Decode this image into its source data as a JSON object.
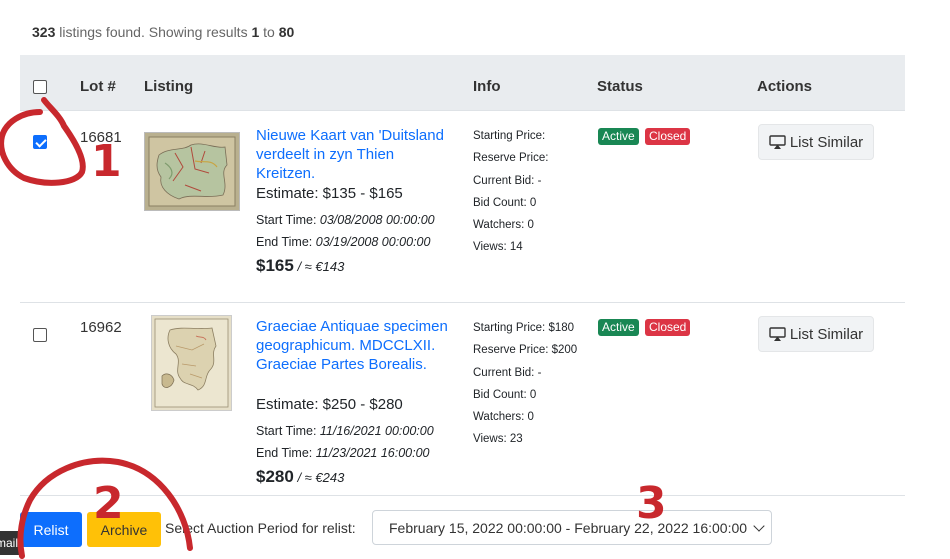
{
  "summary": {
    "count": "323",
    "text1": " listings found. Showing results ",
    "from": "1",
    "text2": " to ",
    "to": "80"
  },
  "columns": {
    "lot": "Lot #",
    "listing": "Listing",
    "info": "Info",
    "status": "Status",
    "actions": "Actions"
  },
  "info_labels": {
    "starting": "Starting Price:",
    "reserve": "Reserve Price:",
    "current": "Current Bid:",
    "bids": "Bid Count:",
    "watchers": "Watchers:",
    "views": "Views:"
  },
  "rows": [
    {
      "checked": true,
      "lot": "16681",
      "title": "Nieuwe Kaart van 'Duitsland verdeelt in zyn Thien Kreitzen.",
      "estimate": "Estimate: $135 - $165",
      "start_label": "Start Time: ",
      "start": "03/08/2008 00:00:00",
      "end_label": "End Time: ",
      "end": "03/19/2008 00:00:00",
      "price": "$165",
      "price_conv": " / ≈ €143",
      "info": {
        "starting": "",
        "reserve": "",
        "current": "-",
        "bids": "0",
        "watchers": "0",
        "views": "14"
      },
      "status": [
        "Active",
        "Closed"
      ],
      "action": "List Similar"
    },
    {
      "checked": false,
      "lot": "16962",
      "title": "Graeciae Antiquae specimen geographicum. MDCCLXII. Graeciae Partes Borealis.",
      "estimate": "Estimate: $250 - $280",
      "start_label": "Start Time: ",
      "start": "11/16/2021 00:00:00",
      "end_label": "End Time: ",
      "end": "11/23/2021 16:00:00",
      "price": "$280",
      "price_conv": " / ≈ €243",
      "info": {
        "starting": "$180",
        "reserve": "$200",
        "current": "-",
        "bids": "0",
        "watchers": "0",
        "views": "23"
      },
      "status": [
        "Active",
        "Closed"
      ],
      "action": "List Similar"
    }
  ],
  "bottom": {
    "relist": "Relist",
    "archive": "Archive",
    "period_label": "Select Auction Period for relist:",
    "period_value": "February 15, 2022 00:00:00 - February 22, 2022 16:00:00"
  },
  "tooltip": "mail",
  "annotations": [
    "1",
    "2",
    "3"
  ],
  "colors": {
    "primary": "#0d6efd",
    "warning": "#ffc107",
    "success": "#198754",
    "danger": "#dc3545",
    "annotation": "#c8282d"
  },
  "icons": {
    "list_similar": "airplay-icon"
  }
}
